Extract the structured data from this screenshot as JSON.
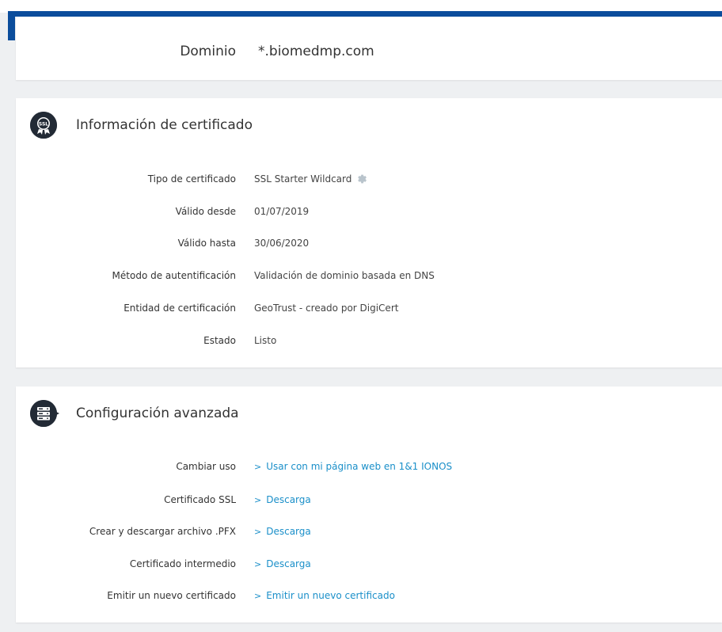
{
  "domain": {
    "label": "Dominio",
    "value": "*.biomedmp.com"
  },
  "certificate_section": {
    "title": "Información de certificado",
    "icon": "ssl-badge-icon",
    "fields": [
      {
        "label": "Tipo de certificado",
        "value": "SSL Starter Wildcard"
      },
      {
        "label": "Válido desde",
        "value": "01/07/2019"
      },
      {
        "label": "Válido hasta",
        "value": "30/06/2020"
      },
      {
        "label": "Método de autentificación",
        "value": "Validación de dominio basada en DNS"
      },
      {
        "label": "Entidad de certificación",
        "value": "GeoTrust - creado por DigiCert"
      },
      {
        "label": "Estado",
        "value": "Listo"
      }
    ]
  },
  "advanced_section": {
    "title": "Configuración avanzada",
    "icon": "server-icon",
    "fields": [
      {
        "label": "Cambiar uso",
        "link": "Usar con mi página web en 1&1 IONOS"
      },
      {
        "label": "Certificado SSL",
        "link": "Descarga"
      },
      {
        "label": "Crear y descargar archivo .PFX",
        "link": "Descarga"
      },
      {
        "label": "Certificado intermedio",
        "link": "Descarga"
      },
      {
        "label": "Emitir un nuevo certificado",
        "link": "Emitir un nuevo certificado"
      }
    ]
  },
  "colors": {
    "brand_blue": "#0b4d9c",
    "link": "#1a8fc9",
    "icon_bg": "#222a35"
  }
}
